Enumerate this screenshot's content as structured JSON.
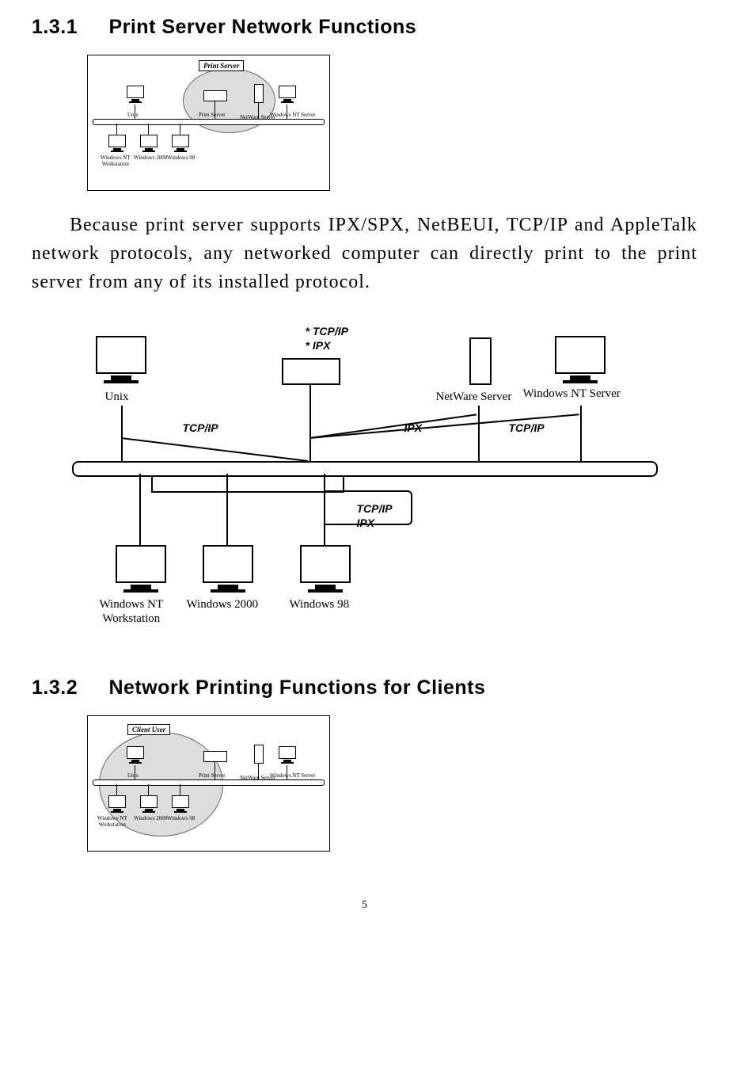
{
  "section1": {
    "number": "1.3.1",
    "title": "Print Server Network Functions"
  },
  "section2": {
    "number": "1.3.2",
    "title": "Network Printing Functions for Clients"
  },
  "paragraph": "Because print server supports IPX/SPX, NetBEUI, TCP/IP and AppleTalk network protocols, any networked computer can directly print to the print server from any of its installed protocol.",
  "diagram1": {
    "badge": "Print Server",
    "labels": {
      "unix": "Unix",
      "printserver": "Print Server",
      "netware": "NetWare Server",
      "ntserver": "Windows NT Server",
      "ntwork": "Windows NT\nWorkstation",
      "w2000": "Windows 2000",
      "w98": "Windows 98"
    }
  },
  "big_diagram": {
    "proto_top": [
      "* TCP/IP",
      "* IPX"
    ],
    "proto_left": "TCP/IP",
    "proto_ipx": "IPX",
    "proto_right": "TCP/IP",
    "bottom_proto": [
      "TCP/IP",
      "IPX"
    ],
    "labels": {
      "unix": "Unix",
      "netware": "NetWare Server",
      "ntserver": "Windows NT Server",
      "ntwork": "Windows NT\nWorkstation",
      "w2000": "Windows 2000",
      "w98": "Windows 98"
    }
  },
  "diagram3": {
    "badge": "Client User",
    "labels": {
      "unix": "Unix",
      "printserver": "Print Server",
      "netware": "NetWare Server",
      "ntserver": "Windows NT Server",
      "ntwork": "Windows NT\nWorkstation",
      "w2000": "Windows 2000",
      "w98": "Windows 98"
    }
  },
  "page_number": "5"
}
